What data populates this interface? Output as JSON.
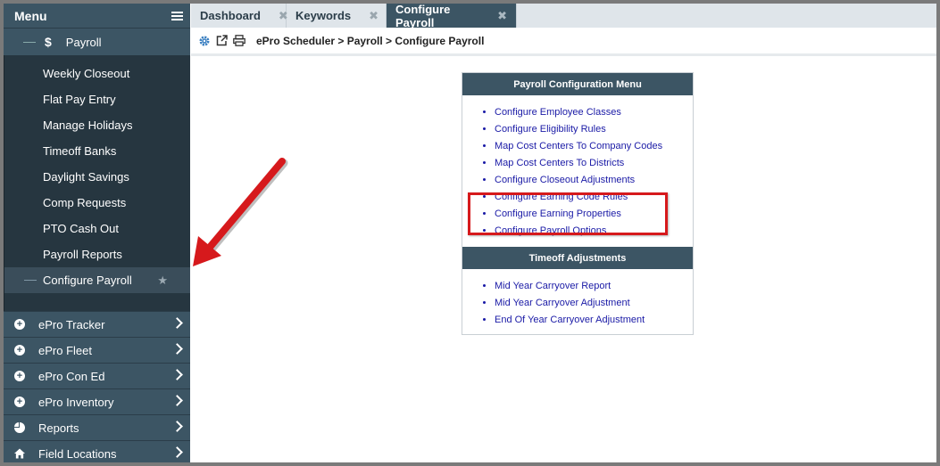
{
  "sidebar": {
    "menu_label": "Menu",
    "section": {
      "label": "Payroll",
      "icon": "dollar-icon"
    },
    "items": [
      {
        "label": "Weekly Closeout"
      },
      {
        "label": "Flat Pay Entry"
      },
      {
        "label": "Manage Holidays"
      },
      {
        "label": "Timeoff Banks"
      },
      {
        "label": "Daylight Savings"
      },
      {
        "label": "Comp Requests"
      },
      {
        "label": "PTO Cash Out"
      },
      {
        "label": "Payroll Reports"
      },
      {
        "label": "Configure Payroll",
        "active": true
      }
    ],
    "modules": [
      {
        "label": "ePro Tracker",
        "icon": "plus-circle-icon"
      },
      {
        "label": "ePro Fleet",
        "icon": "plus-circle-icon"
      },
      {
        "label": "ePro Con Ed",
        "icon": "plus-circle-icon"
      },
      {
        "label": "ePro Inventory",
        "icon": "plus-circle-icon"
      },
      {
        "label": "Reports",
        "icon": "pie-chart-icon"
      },
      {
        "label": "Field Locations",
        "icon": "home-icon"
      }
    ]
  },
  "tabs": [
    {
      "label": "Dashboard"
    },
    {
      "label": "Keywords"
    },
    {
      "label": "Configure Payroll",
      "active": true
    }
  ],
  "breadcrumb": "ePro Scheduler > Payroll > Configure Payroll",
  "panel": {
    "title": "Payroll Configuration Menu",
    "links": [
      "Configure Employee Classes",
      "Configure Eligibility Rules",
      "Map Cost Centers To Company Codes",
      "Map Cost Centers To Districts",
      "Configure Closeout Adjustments",
      "Configure Earning Code Rules",
      "Configure Earning Properties",
      "Configure Payroll Options"
    ],
    "section2_title": "Timeoff Adjustments",
    "section2_links": [
      "Mid Year Carryover Report",
      "Mid Year Carryover Adjustment",
      "End Of Year Carryover Adjustment"
    ]
  },
  "colors": {
    "sidebar_dark": "#263640",
    "sidebar_mid": "#3c5564",
    "link": "#1a1aa6",
    "annotation": "#d6191c"
  }
}
